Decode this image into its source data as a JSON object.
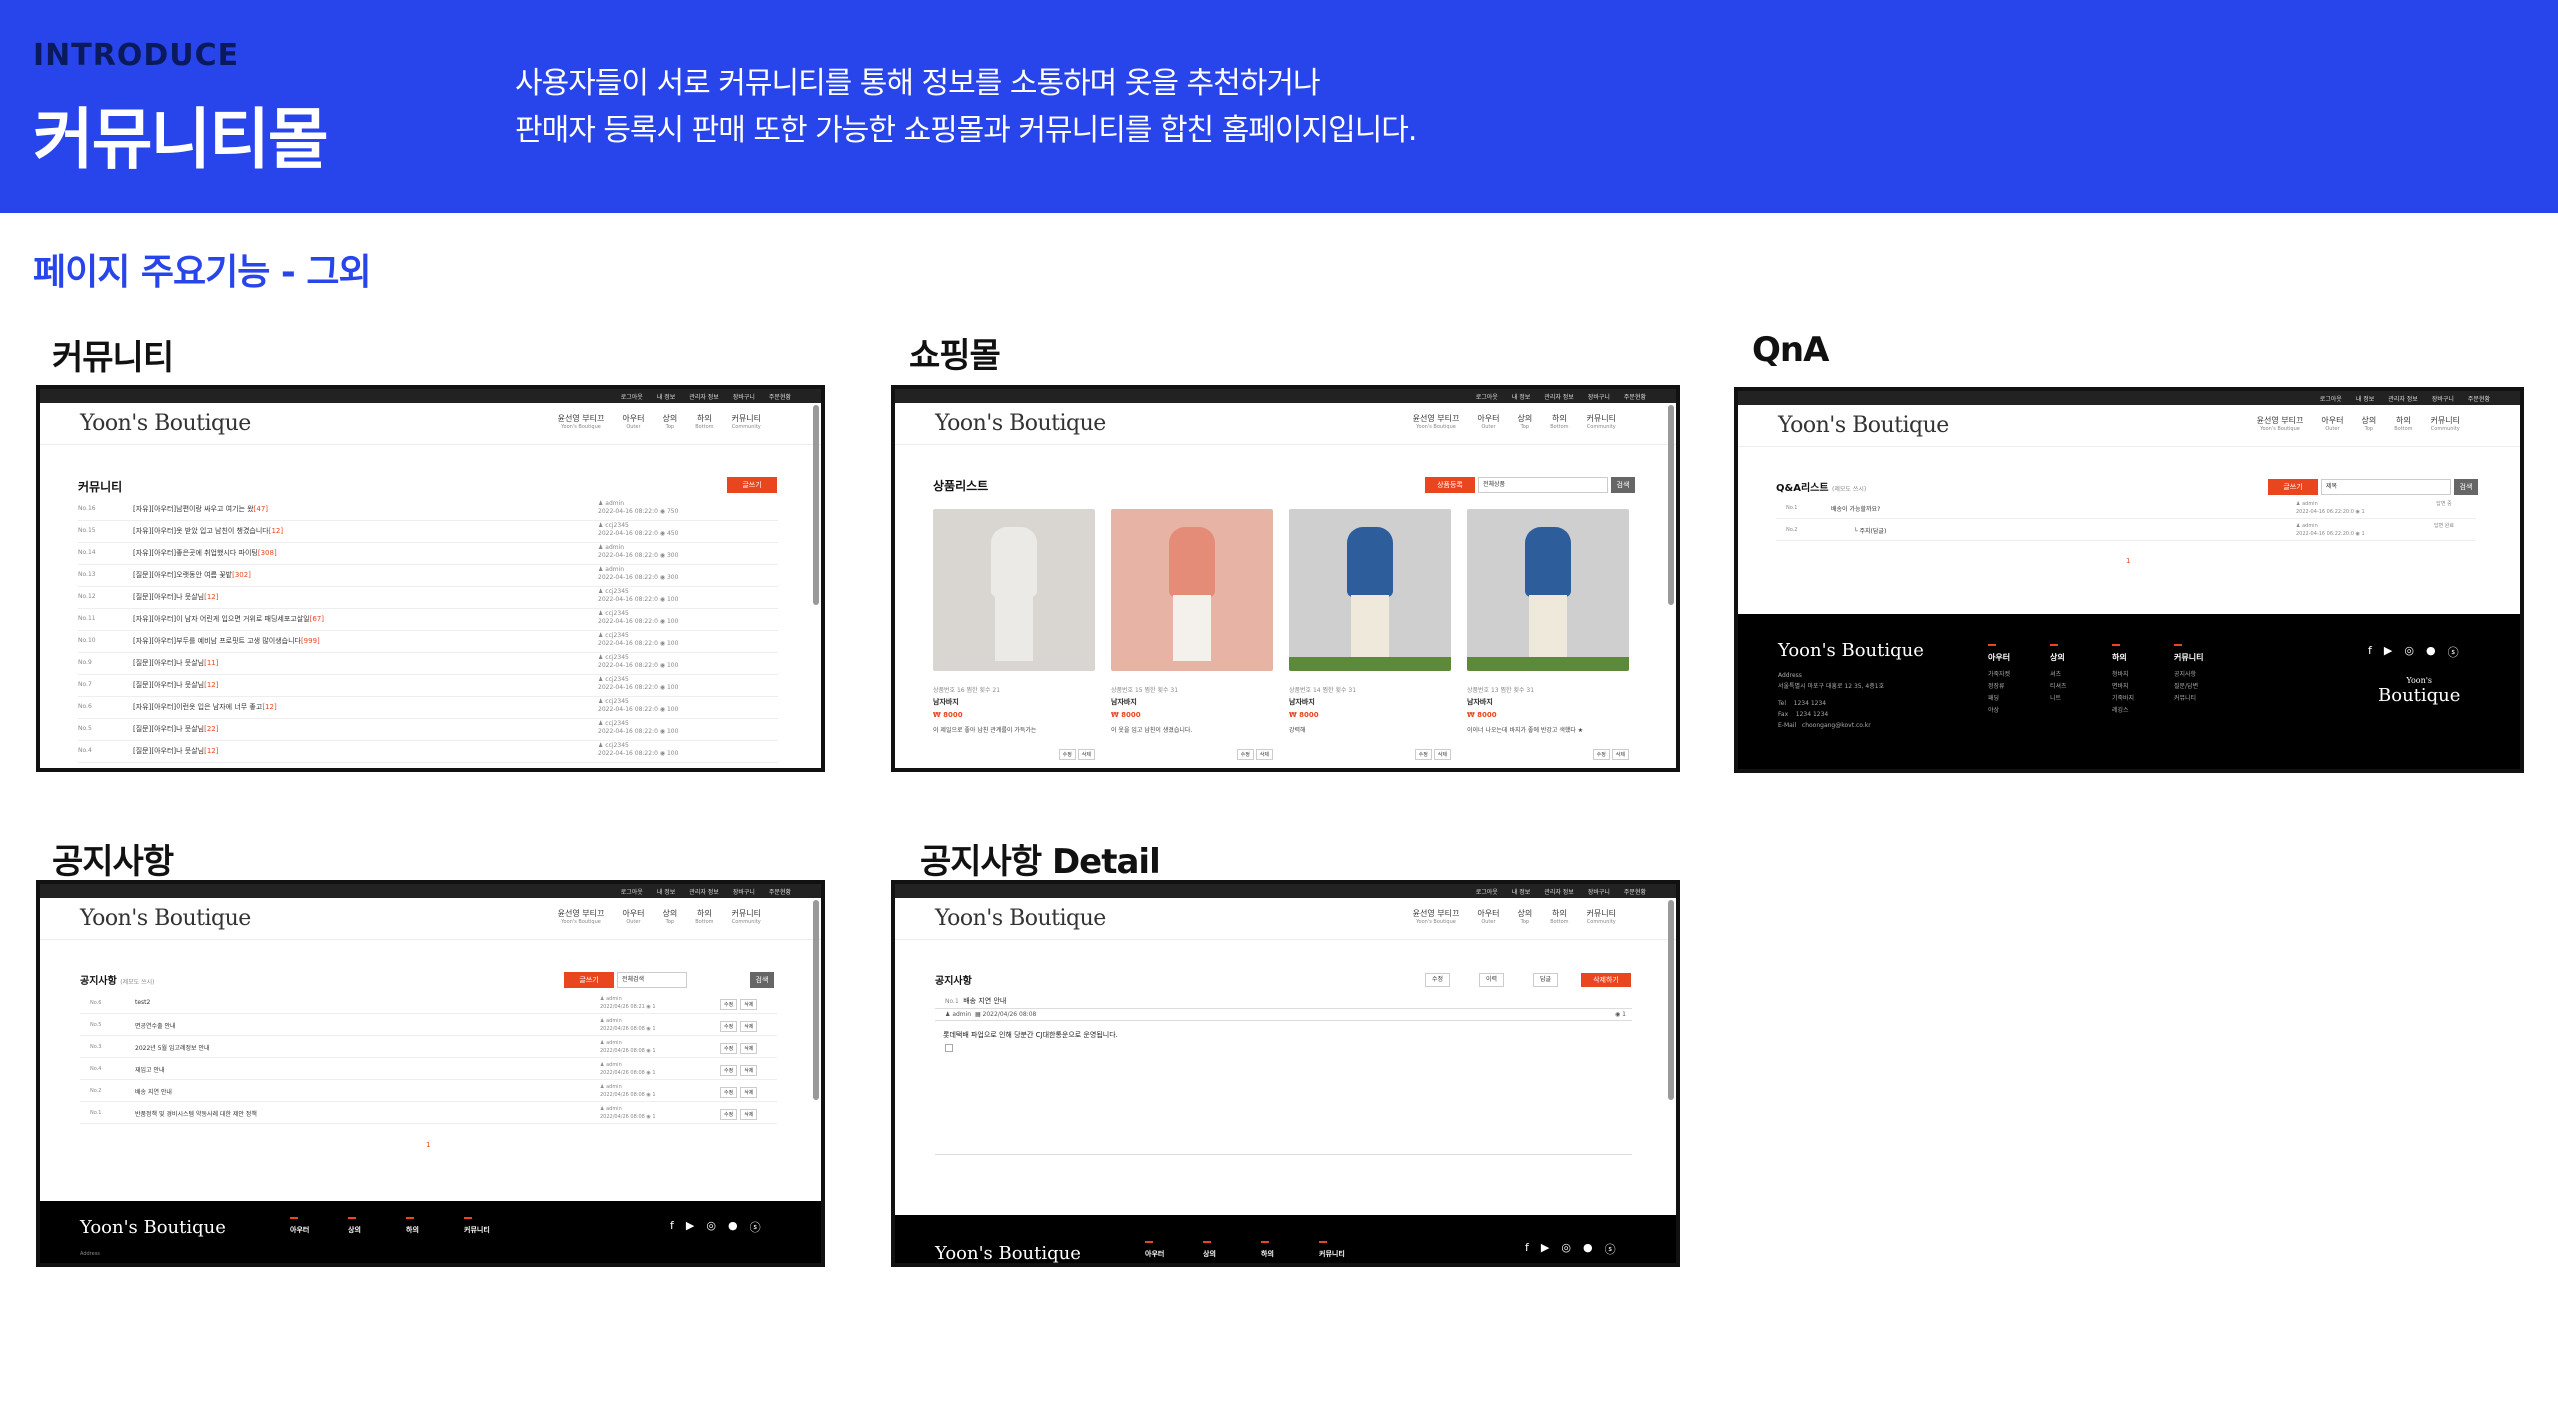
{
  "header": {
    "intro": "INTRODUCE",
    "title": "커뮤니티몰",
    "desc_line1": "사용자들이 서로 커뮤니티를 통해 정보를 소통하며 옷을 추천하거나",
    "desc_line2": "판매자 등록시 판매 또한 가능한 쇼핑몰과 커뮤니티를 합친 홈페이지입니다."
  },
  "section_title": "페이지 주요기능 - 그외",
  "site": {
    "logo": "Yoon's Boutique",
    "topbar": [
      "로그아웃",
      "내 정보",
      "관리자 정보",
      "장바구니",
      "주문현황"
    ],
    "menu": [
      {
        "label": "윤선영 부티끄",
        "sub": "Yoon's Boutique"
      },
      {
        "label": "아우터",
        "sub": "Outer"
      },
      {
        "label": "상의",
        "sub": "Top"
      },
      {
        "label": "하의",
        "sub": "Bottom"
      },
      {
        "label": "커뮤니티",
        "sub": "Community"
      }
    ]
  },
  "cards": {
    "community": {
      "label": "커뮤니티",
      "page_title": "커뮤니티",
      "write_btn": "글쓰기",
      "rows": [
        {
          "no": "No.16",
          "title": "[자유][아우터]남편이랑 싸우고 여기는 왔",
          "count": "[47]",
          "author": "admin",
          "date": "2022-04-16 08:22:0",
          "views": "750"
        },
        {
          "no": "No.15",
          "title": "[자유][아우터]옷 받았 입고 남친이 챙겼습니다",
          "count": "[12]",
          "author": "ccj2345",
          "date": "2022-04-16 08:22:0",
          "views": "450"
        },
        {
          "no": "No.14",
          "title": "[자유][아우터]좋은곳에 취업했시다 파이팅",
          "count": "[308]",
          "author": "admin",
          "date": "2022-04-16 08:22:0",
          "views": "300"
        },
        {
          "no": "No.13",
          "title": "[질문][아우터]오랫동안 여름 꽃밭",
          "count": "[302]",
          "author": "admin",
          "date": "2022-04-16 08:22:0",
          "views": "300"
        },
        {
          "no": "No.12",
          "title": "[질문][아우터]나 뭇살님",
          "count": "[12]",
          "author": "ccj2345",
          "date": "2022-04-16 08:22:0",
          "views": "100"
        },
        {
          "no": "No.11",
          "title": "[자유][아우터]이 남자 어린게 입으면 거위로 패딩세포고살일",
          "count": "[67]",
          "author": "ccj2345",
          "date": "2022-04-16 08:22:0",
          "views": "100"
        },
        {
          "no": "No.10",
          "title": "[자유][아우터]부두를 예비남 프로핏트 고생 많이생습니다",
          "count": "[999]",
          "author": "ccj2345",
          "date": "2022-04-16 08:22:0",
          "views": "100"
        },
        {
          "no": "No.9",
          "title": "[질문][아우터]나 뭇살님",
          "count": "[11]",
          "author": "ccj2345",
          "date": "2022-04-16 08:22:0",
          "views": "100"
        },
        {
          "no": "No.7",
          "title": "[질문][아우터]나 뭇살님",
          "count": "[12]",
          "author": "ccj2345",
          "date": "2022-04-16 08:22:0",
          "views": "100"
        },
        {
          "no": "No.6",
          "title": "[자유][아우터]이런옷 입은 남자에 너무 좋고",
          "count": "[12]",
          "author": "ccj2345",
          "date": "2022-04-16 08:22:0",
          "views": "100"
        },
        {
          "no": "No.5",
          "title": "[질문][아우터]나 뭇살님",
          "count": "[22]",
          "author": "ccj2345",
          "date": "2022-04-16 08:22:0",
          "views": "100"
        },
        {
          "no": "No.4",
          "title": "[질문][아우터]나 뭇살님",
          "count": "[12]",
          "author": "ccj2345",
          "date": "2022-04-16 08:22:0",
          "views": "100"
        }
      ]
    },
    "shop": {
      "label": "쇼핑몰",
      "page_title": "상품리스트",
      "write_btn": "상품등록",
      "select": "전체상품",
      "search_btn": "검색",
      "products": [
        {
          "info": "상품번호 16   찜한 횟수 21",
          "name": "남자바지",
          "price": "₩ 8000",
          "desc": "이 제일으로 좋아 남친 관계를이 가득가는",
          "color": "#d9d6d2"
        },
        {
          "info": "상품번호 15   찜한 횟수 31",
          "name": "남자바지",
          "price": "₩ 8000",
          "desc": "이 옷을 입고 남친이 생겼습니다.",
          "color": "#e6b3a4"
        },
        {
          "info": "상품번호 14   찜한 횟수 31",
          "name": "남자바지",
          "price": "₩ 8000",
          "desc": "강력해",
          "color": "#cfcfcf"
        },
        {
          "info": "상품번호 13   찜한 횟수 31",
          "name": "남자바지",
          "price": "₩ 8000",
          "desc": "이이너 나오는데 바지가 좋에 반강고 색했다 ★",
          "color": "#cfcfcf"
        }
      ],
      "item_btns": [
        "수정",
        "삭제"
      ]
    },
    "qna": {
      "label": "QnA",
      "page_title": "Q&A리스트",
      "page_sub": "(제모도 쓰시)",
      "write_btn": "글쓰기",
      "select": "제목",
      "search_btn": "검색",
      "rows": [
        {
          "no": "No.1",
          "title": "배송이 가능할까요?",
          "author": "admin",
          "date": "2022-04-16 06:22:20:0",
          "views": "1",
          "status": "답변 중"
        },
        {
          "no": "No.2",
          "title": "└ 주지(답글)",
          "author": "admin",
          "date": "2022-04-16 06:22:20:0",
          "views": "1",
          "status": "답변 완료"
        }
      ],
      "pager": "1",
      "footer": {
        "logo": "Yoon's Boutique",
        "address_label": "Address",
        "address": "서울특별시 마포구 대흥로 12 35, 4층1호",
        "tel_label": "Tel",
        "tel": "1234 1234",
        "fax_label": "Fax",
        "fax": "1234 1234",
        "mail_label": "E-Mail",
        "mail": "choongang@kovt.co.kr",
        "cols": [
          {
            "title": "아우터",
            "items": [
              "가죽자켓",
              "정장류",
              "패딩",
              "야상"
            ]
          },
          {
            "title": "상의",
            "items": [
              "셔츠",
              "티셔츠",
              "니트"
            ]
          },
          {
            "title": "하의",
            "items": [
              "청바지",
              "면바지",
              "기죽바지",
              "레깅스"
            ]
          },
          {
            "title": "커뮤니티",
            "items": [
              "공지사항",
              "질문/답변",
              "커뮤니티"
            ]
          }
        ],
        "brand_small": "Yoon's",
        "brand_large": "Boutique"
      }
    },
    "notice": {
      "label": "공지사항",
      "page_title": "공지사항",
      "page_sub": "(제모도 쓰시)",
      "write_btn": "글쓰기",
      "select": "전체검색",
      "search_btn": "검색",
      "rows": [
        {
          "no": "No.6",
          "title": "test2",
          "author": "admin",
          "date": "2022/04/26 08:21",
          "views": "1"
        },
        {
          "no": "No.5",
          "title": "면공연수출 안내",
          "author": "admin",
          "date": "2022/04/26 08:08",
          "views": "1"
        },
        {
          "no": "No.3",
          "title": "2022년 5월 임고례정보 안내",
          "author": "admin",
          "date": "2022/04/26 08:08",
          "views": "1"
        },
        {
          "no": "No.4",
          "title": "재입고 안내",
          "author": "admin",
          "date": "2022/04/26 08:08",
          "views": "1"
        },
        {
          "no": "No.2",
          "title": "배송 지연 안내",
          "author": "admin",
          "date": "2022/04/26 08:08",
          "views": "1"
        },
        {
          "no": "No.1",
          "title": "반품정책 및 경비시스템 약동사례 대한 제안 정책",
          "author": "admin",
          "date": "2022/04/26 08:08",
          "views": "1"
        }
      ],
      "row_btns": [
        "수정",
        "삭제"
      ],
      "pager": "1",
      "footer": {
        "logo": "Yoon's Boutique",
        "cols": [
          "아우터",
          "상의",
          "하의",
          "커뮤니티"
        ],
        "address_label": "Address"
      }
    },
    "notice_detail": {
      "label": "공지사항 Detail",
      "page_title": "공지사항",
      "btns": [
        "수정",
        "이력",
        "답글",
        "삭제하기"
      ],
      "no": "No.1",
      "title": "배송 지연 안내",
      "author": "admin",
      "date": "2022/04/26 08:08",
      "views": "1",
      "body": "롯데택배 파업으로 인해 당분간 CJ대한통운으로 운영됩니다.",
      "footer": {
        "logo": "Yoon's Boutique",
        "cols": [
          "아우터",
          "상의",
          "하의",
          "커뮤니티"
        ]
      }
    }
  },
  "colors": {
    "primary": "#2845ec",
    "accent": "#e9461f"
  },
  "social_icons": [
    "facebook-icon",
    "youtube-icon",
    "instagram-icon",
    "chat-icon",
    "skype-icon"
  ]
}
